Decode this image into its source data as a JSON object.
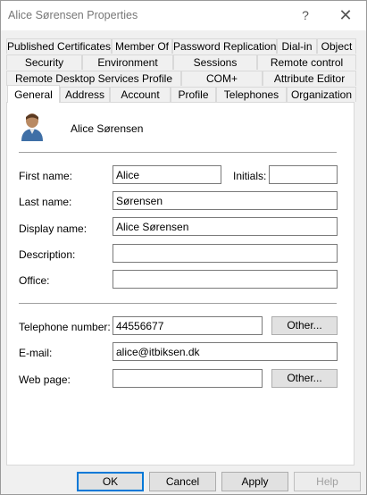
{
  "window": {
    "title": "Alice Sørensen Properties",
    "help_glyph": "?",
    "close_glyph": "✕"
  },
  "tabs": {
    "row1": [
      "Published Certificates",
      "Member Of",
      "Password Replication",
      "Dial-in",
      "Object"
    ],
    "row2": [
      "Security",
      "Environment",
      "Sessions",
      "Remote control"
    ],
    "row3": [
      "Remote Desktop Services Profile",
      "COM+",
      "Attribute Editor"
    ],
    "row4": [
      "General",
      "Address",
      "Account",
      "Profile",
      "Telephones",
      "Organization"
    ],
    "active": "General"
  },
  "general": {
    "user_icon": "user-icon",
    "display_header": "Alice Sørensen",
    "first_name_label": "First name:",
    "first_name_value": "Alice",
    "initials_label": "Initials:",
    "initials_value": "",
    "last_name_label": "Last name:",
    "last_name_value": "Sørensen",
    "display_name_label": "Display name:",
    "display_name_value": "Alice Sørensen",
    "description_label": "Description:",
    "description_value": "",
    "office_label": "Office:",
    "office_value": "",
    "telephone_label": "Telephone number:",
    "telephone_value": "44556677",
    "email_label": "E-mail:",
    "email_value": "alice@itbiksen.dk",
    "webpage_label": "Web page:",
    "webpage_value": "",
    "other_label": "Other..."
  },
  "footer": {
    "ok": "OK",
    "cancel": "Cancel",
    "apply": "Apply",
    "help": "Help"
  }
}
